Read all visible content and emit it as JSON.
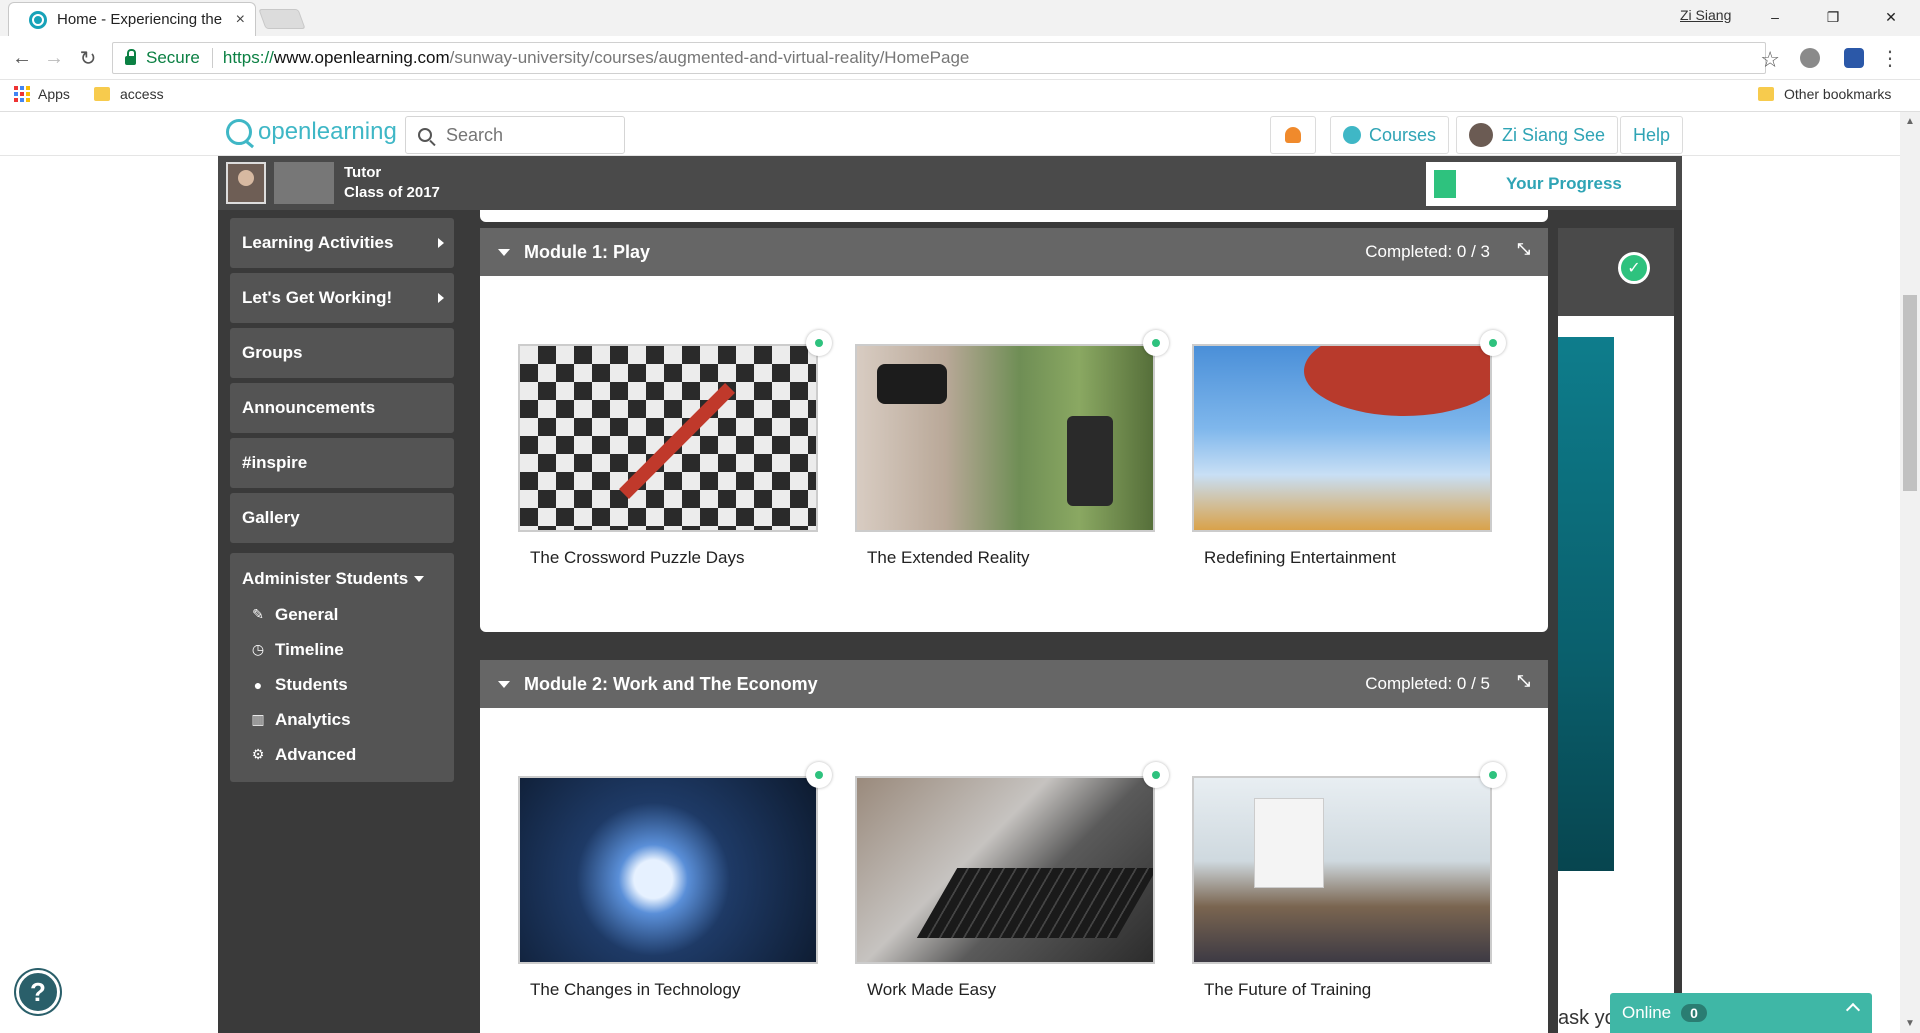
{
  "browser": {
    "tab_title": "Home - Experiencing the",
    "tab_close": "×",
    "profile_name": "Zi Siang",
    "secure_label": "Secure",
    "url_scheme": "https://",
    "url_host": "www.openlearning.com",
    "url_path": "/sunway-university/courses/augmented-and-virtual-reality/HomePage",
    "bookmarks": [
      "Apps",
      "access"
    ],
    "other_bookmarks": "Other bookmarks",
    "window_controls": [
      "–",
      "❐",
      "✕"
    ]
  },
  "site": {
    "logo_text": "openlearning",
    "search_placeholder": "Search",
    "courses_label": "Courses",
    "user_name": "Zi Siang See",
    "help_label": "Help"
  },
  "course": {
    "role": "Tutor",
    "class_name": "Class of 2017",
    "progress_label": "Your Progress",
    "progress_fraction": 0.1
  },
  "sidebar": {
    "items": [
      {
        "label": "Learning Activities",
        "arrow": true
      },
      {
        "label": "Let's Get Working!",
        "arrow": true
      },
      {
        "label": "Groups",
        "arrow": false
      },
      {
        "label": "Announcements",
        "arrow": false
      },
      {
        "label": "#inspire",
        "arrow": false
      },
      {
        "label": "Gallery",
        "arrow": false
      }
    ],
    "admin_title": "Administer Students",
    "admin_items": [
      {
        "label": "General",
        "icon": "edit-icon"
      },
      {
        "label": "Timeline",
        "icon": "clock-icon"
      },
      {
        "label": "Students",
        "icon": "user-icon"
      },
      {
        "label": "Analytics",
        "icon": "bar-chart-icon"
      },
      {
        "label": "Advanced",
        "icon": "gears-icon"
      }
    ]
  },
  "modules": [
    {
      "title": "Module 1: Play",
      "completed": "Completed: 0 / 3",
      "cards": [
        {
          "title": "The Crossword Puzzle Days"
        },
        {
          "title": "The Extended Reality"
        },
        {
          "title": "Redefining Entertainment"
        }
      ]
    },
    {
      "title": "Module 2: Work and The Economy",
      "completed": "Completed: 0 / 5",
      "cards": [
        {
          "title": "The Changes in Technology"
        },
        {
          "title": "Work Made Easy"
        },
        {
          "title": "The Future of Training"
        }
      ]
    }
  ],
  "right_panel": {
    "ask_text": "ask yo"
  },
  "chat": {
    "online_label": "Online",
    "online_count": "0"
  },
  "help_bubble": "?",
  "colors": {
    "brand": "#3fb7c6",
    "sidebar_bg": "#545454",
    "module_header": "#666666",
    "complete_green": "#2ec27e",
    "online_bar": "#3fb7a6"
  }
}
